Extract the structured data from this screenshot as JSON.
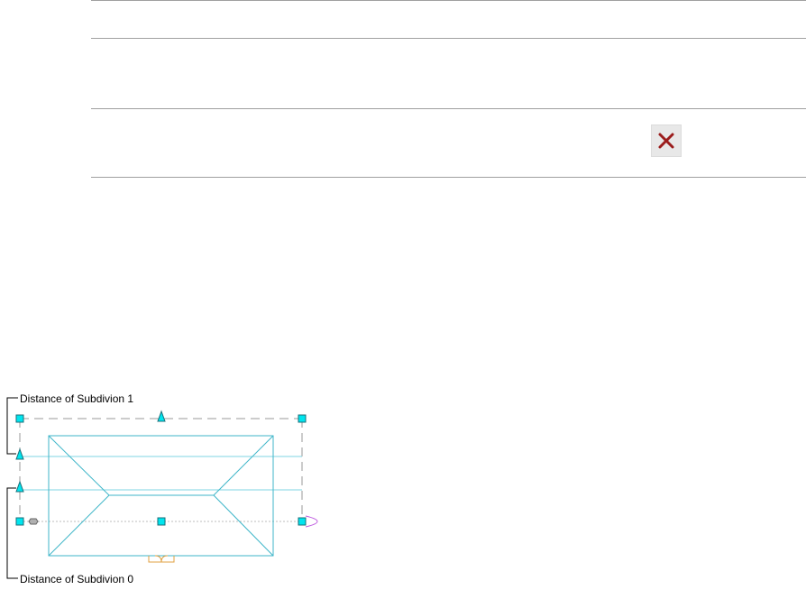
{
  "labels": {
    "subdivision_1": "Distance of Subdivion 1",
    "subdivision_0": "Distance of Subdivion 0"
  },
  "icons": {
    "close": "close-x-icon"
  },
  "colors": {
    "roof_outline": "#3fb6c9",
    "grip_fill": "#00e5ee",
    "dashed_line": "#9a9a9a",
    "close_icon": "#9b1c1c",
    "door_swing": "#e0a040",
    "rotation_grip": "#c060e0"
  }
}
